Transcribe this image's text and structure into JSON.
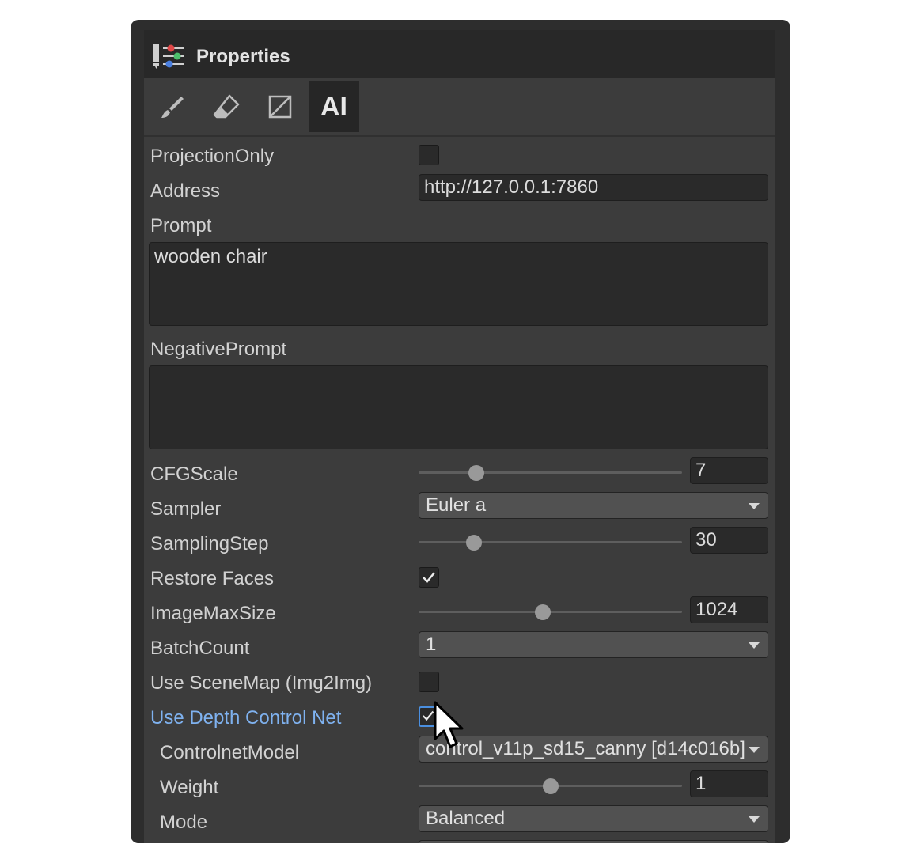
{
  "window": {
    "title": "Properties",
    "title_icon": "sliders-icon"
  },
  "toolbar": {
    "tools": [
      {
        "name": "brush-icon",
        "active": false
      },
      {
        "name": "eraser-icon",
        "active": false
      },
      {
        "name": "projection-icon",
        "active": false
      },
      {
        "name": "ai-tab",
        "label": "AI",
        "active": true
      }
    ]
  },
  "fields": {
    "projection_only": {
      "label": "ProjectionOnly",
      "checked": false
    },
    "address": {
      "label": "Address",
      "value": "http://127.0.0.1:7860"
    },
    "prompt": {
      "label": "Prompt",
      "value": "wooden chair"
    },
    "negative_prompt": {
      "label": "NegativePrompt",
      "value": ""
    },
    "cfg_scale": {
      "label": "CFGScale",
      "value": "7",
      "slider_fraction": 0.22
    },
    "sampler": {
      "label": "Sampler",
      "value": "Euler a"
    },
    "sampling_step": {
      "label": "SamplingStep",
      "value": "30",
      "slider_fraction": 0.21
    },
    "restore_faces": {
      "label": "Restore Faces",
      "checked": true
    },
    "image_max_size": {
      "label": "ImageMaxSize",
      "value": "1024",
      "slider_fraction": 0.47
    },
    "batch_count": {
      "label": "BatchCount",
      "value": "1"
    },
    "use_scene_map": {
      "label": "Use SceneMap (Img2Img)",
      "checked": false
    },
    "use_depth_control_net": {
      "label": "Use Depth Control Net",
      "checked": true,
      "highlight_color": "#7fb2f0"
    },
    "controlnet_model": {
      "label": "ControlnetModel",
      "value": "control_v11p_sd15_canny [d14c016b]"
    },
    "weight": {
      "label": "Weight",
      "value": "1",
      "slider_fraction": 0.5
    },
    "mode": {
      "label": "Mode",
      "value": "Balanced"
    }
  },
  "colors": {
    "panel_bg": "#3c3c3c",
    "header_bg": "#282828",
    "field_bg": "#2a2a2a",
    "dropdown_bg": "#515151",
    "label_text": "#d2d2d2",
    "focus_accent": "#4a8fe0"
  }
}
